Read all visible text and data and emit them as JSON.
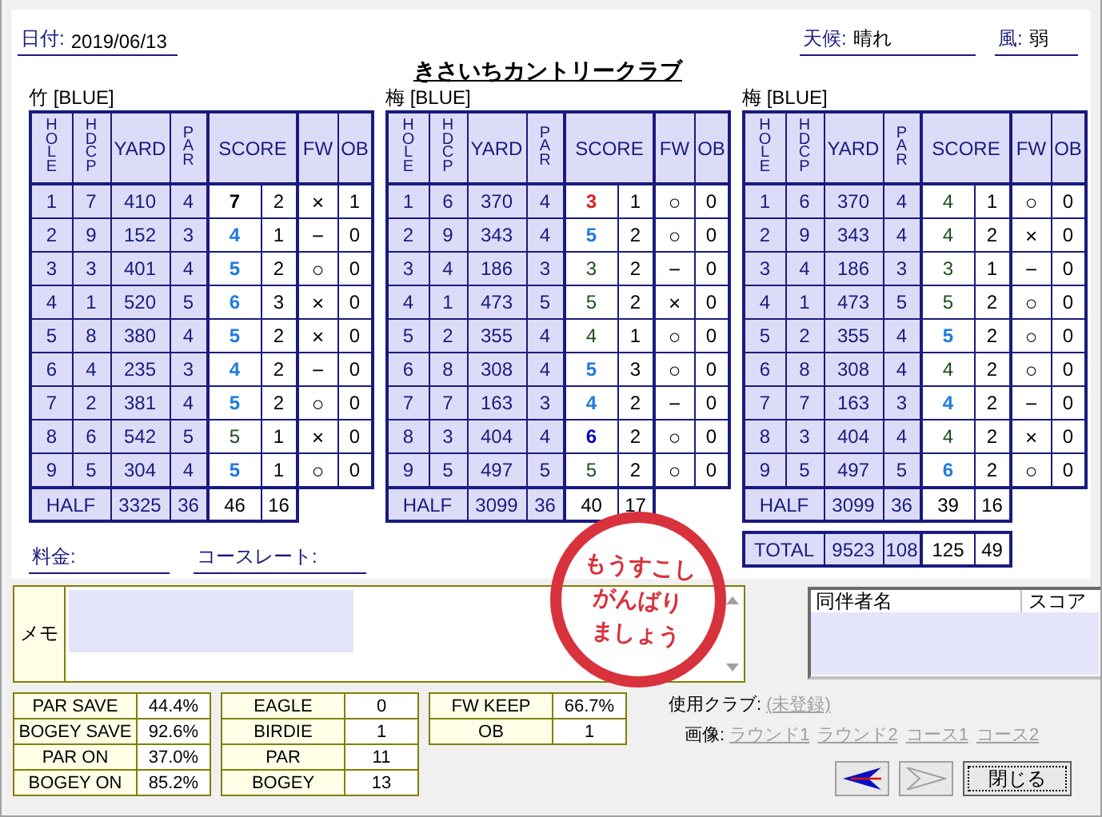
{
  "header": {
    "date": {
      "label": "日付:",
      "value": "2019/06/13"
    },
    "weather": {
      "label": "天候:",
      "value": "晴れ"
    },
    "wind": {
      "label": "風:",
      "value": "弱"
    }
  },
  "title": "きさいちカントリークラブ",
  "tables": [
    {
      "label": "竹 [BLUE]",
      "columns": [
        "HOLE",
        "HDCP",
        "YARD",
        "PAR",
        "SCORE",
        "FW",
        "OB"
      ],
      "rows": [
        {
          "hole": "1",
          "hdcp": "7",
          "yard": "410",
          "par": "4",
          "score": "7",
          "putts": "2",
          "fw": "×",
          "ob": "1",
          "color": "#000000",
          "bold": true
        },
        {
          "hole": "2",
          "hdcp": "9",
          "yard": "152",
          "par": "3",
          "score": "4",
          "putts": "1",
          "fw": "−",
          "ob": "0",
          "color": "#1e7be0",
          "bold": true
        },
        {
          "hole": "3",
          "hdcp": "3",
          "yard": "401",
          "par": "4",
          "score": "5",
          "putts": "2",
          "fw": "○",
          "ob": "0",
          "color": "#1e7be0",
          "bold": true
        },
        {
          "hole": "4",
          "hdcp": "1",
          "yard": "520",
          "par": "5",
          "score": "6",
          "putts": "3",
          "fw": "×",
          "ob": "0",
          "color": "#1e7be0",
          "bold": true
        },
        {
          "hole": "5",
          "hdcp": "8",
          "yard": "380",
          "par": "4",
          "score": "5",
          "putts": "2",
          "fw": "×",
          "ob": "0",
          "color": "#1e7be0",
          "bold": true
        },
        {
          "hole": "6",
          "hdcp": "4",
          "yard": "235",
          "par": "3",
          "score": "4",
          "putts": "2",
          "fw": "−",
          "ob": "0",
          "color": "#1e7be0",
          "bold": true
        },
        {
          "hole": "7",
          "hdcp": "2",
          "yard": "381",
          "par": "4",
          "score": "5",
          "putts": "2",
          "fw": "○",
          "ob": "0",
          "color": "#1e7be0",
          "bold": true
        },
        {
          "hole": "8",
          "hdcp": "6",
          "yard": "542",
          "par": "5",
          "score": "5",
          "putts": "1",
          "fw": "×",
          "ob": "0",
          "color": "#1a501a",
          "bold": false
        },
        {
          "hole": "9",
          "hdcp": "5",
          "yard": "304",
          "par": "4",
          "score": "5",
          "putts": "1",
          "fw": "○",
          "ob": "0",
          "color": "#1e7be0",
          "bold": true
        }
      ],
      "half": {
        "label": "HALF",
        "yard": "3325",
        "par": "36",
        "score": "46",
        "putts": "16"
      }
    },
    {
      "label": "梅 [BLUE]",
      "columns": [
        "HOLE",
        "HDCP",
        "YARD",
        "PAR",
        "SCORE",
        "FW",
        "OB"
      ],
      "rows": [
        {
          "hole": "1",
          "hdcp": "6",
          "yard": "370",
          "par": "4",
          "score": "3",
          "putts": "1",
          "fw": "○",
          "ob": "0",
          "color": "#e02020",
          "bold": true
        },
        {
          "hole": "2",
          "hdcp": "9",
          "yard": "343",
          "par": "4",
          "score": "5",
          "putts": "2",
          "fw": "○",
          "ob": "0",
          "color": "#1e7be0",
          "bold": true
        },
        {
          "hole": "3",
          "hdcp": "4",
          "yard": "186",
          "par": "3",
          "score": "3",
          "putts": "2",
          "fw": "−",
          "ob": "0",
          "color": "#1a501a",
          "bold": false
        },
        {
          "hole": "4",
          "hdcp": "1",
          "yard": "473",
          "par": "5",
          "score": "5",
          "putts": "2",
          "fw": "×",
          "ob": "0",
          "color": "#1a501a",
          "bold": false
        },
        {
          "hole": "5",
          "hdcp": "2",
          "yard": "355",
          "par": "4",
          "score": "4",
          "putts": "1",
          "fw": "○",
          "ob": "0",
          "color": "#1a501a",
          "bold": false
        },
        {
          "hole": "6",
          "hdcp": "8",
          "yard": "308",
          "par": "4",
          "score": "5",
          "putts": "3",
          "fw": "○",
          "ob": "0",
          "color": "#1e7be0",
          "bold": true
        },
        {
          "hole": "7",
          "hdcp": "7",
          "yard": "163",
          "par": "3",
          "score": "4",
          "putts": "2",
          "fw": "−",
          "ob": "0",
          "color": "#1e7be0",
          "bold": true
        },
        {
          "hole": "8",
          "hdcp": "3",
          "yard": "404",
          "par": "4",
          "score": "6",
          "putts": "2",
          "fw": "○",
          "ob": "0",
          "color": "#0000c0",
          "bold": true
        },
        {
          "hole": "9",
          "hdcp": "5",
          "yard": "497",
          "par": "5",
          "score": "5",
          "putts": "2",
          "fw": "○",
          "ob": "0",
          "color": "#1a501a",
          "bold": false
        }
      ],
      "half": {
        "label": "HALF",
        "yard": "3099",
        "par": "36",
        "score": "40",
        "putts": "17"
      }
    },
    {
      "label": "梅 [BLUE]",
      "columns": [
        "HOLE",
        "HDCP",
        "YARD",
        "PAR",
        "SCORE",
        "FW",
        "OB"
      ],
      "rows": [
        {
          "hole": "1",
          "hdcp": "6",
          "yard": "370",
          "par": "4",
          "score": "4",
          "putts": "1",
          "fw": "○",
          "ob": "0",
          "color": "#1a501a",
          "bold": false
        },
        {
          "hole": "2",
          "hdcp": "9",
          "yard": "343",
          "par": "4",
          "score": "4",
          "putts": "2",
          "fw": "×",
          "ob": "0",
          "color": "#1a501a",
          "bold": false
        },
        {
          "hole": "3",
          "hdcp": "4",
          "yard": "186",
          "par": "3",
          "score": "3",
          "putts": "1",
          "fw": "−",
          "ob": "0",
          "color": "#1a501a",
          "bold": false
        },
        {
          "hole": "4",
          "hdcp": "1",
          "yard": "473",
          "par": "5",
          "score": "5",
          "putts": "2",
          "fw": "○",
          "ob": "0",
          "color": "#1a501a",
          "bold": false
        },
        {
          "hole": "5",
          "hdcp": "2",
          "yard": "355",
          "par": "4",
          "score": "5",
          "putts": "2",
          "fw": "○",
          "ob": "0",
          "color": "#1e7be0",
          "bold": true
        },
        {
          "hole": "6",
          "hdcp": "8",
          "yard": "308",
          "par": "4",
          "score": "4",
          "putts": "2",
          "fw": "○",
          "ob": "0",
          "color": "#1a501a",
          "bold": false
        },
        {
          "hole": "7",
          "hdcp": "7",
          "yard": "163",
          "par": "3",
          "score": "4",
          "putts": "2",
          "fw": "−",
          "ob": "0",
          "color": "#1e7be0",
          "bold": true
        },
        {
          "hole": "8",
          "hdcp": "3",
          "yard": "404",
          "par": "4",
          "score": "4",
          "putts": "2",
          "fw": "×",
          "ob": "0",
          "color": "#1a501a",
          "bold": false
        },
        {
          "hole": "9",
          "hdcp": "5",
          "yard": "497",
          "par": "5",
          "score": "6",
          "putts": "2",
          "fw": "○",
          "ob": "0",
          "color": "#1e7be0",
          "bold": true
        }
      ],
      "half": {
        "label": "HALF",
        "yard": "3099",
        "par": "36",
        "score": "39",
        "putts": "16"
      },
      "total": {
        "label": "TOTAL",
        "yard": "9523",
        "par": "108",
        "score": "125",
        "putts": "49"
      }
    }
  ],
  "fee": {
    "label": "料金:"
  },
  "course_rate": {
    "label": "コースレート:"
  },
  "memo": {
    "label": "メモ"
  },
  "stamp": {
    "lines": [
      "もうすこし",
      "がんばり",
      "ましょう"
    ]
  },
  "stats": [
    [
      {
        "label": "PAR SAVE",
        "value": "44.4%"
      },
      {
        "label": "BOGEY SAVE",
        "value": "92.6%"
      },
      {
        "label": "PAR ON",
        "value": "37.0%"
      },
      {
        "label": "BOGEY ON",
        "value": "85.2%"
      }
    ],
    [
      {
        "label": "EAGLE",
        "value": "0"
      },
      {
        "label": "BIRDIE",
        "value": "1"
      },
      {
        "label": "PAR",
        "value": "11"
      },
      {
        "label": "BOGEY",
        "value": "13"
      }
    ],
    [
      {
        "label": "FW KEEP",
        "value": "66.7%"
      },
      {
        "label": "OB",
        "value": "1"
      }
    ]
  ],
  "companions": {
    "columns": [
      "同伴者名",
      "スコア"
    ]
  },
  "clubs": {
    "label": "使用クラブ:",
    "link": {
      "text": "(未登録)",
      "disabled": true
    }
  },
  "images": {
    "label": "画像:",
    "links": [
      {
        "text": "ラウンド1",
        "disabled": true
      },
      {
        "text": "ラウンド2",
        "disabled": true
      },
      {
        "text": "コース1",
        "disabled": true
      },
      {
        "text": "コース2",
        "disabled": true
      }
    ]
  },
  "buttons": {
    "back": {
      "disabled": false
    },
    "forward": {
      "disabled": true
    },
    "close": {
      "label": "閉じる"
    }
  }
}
